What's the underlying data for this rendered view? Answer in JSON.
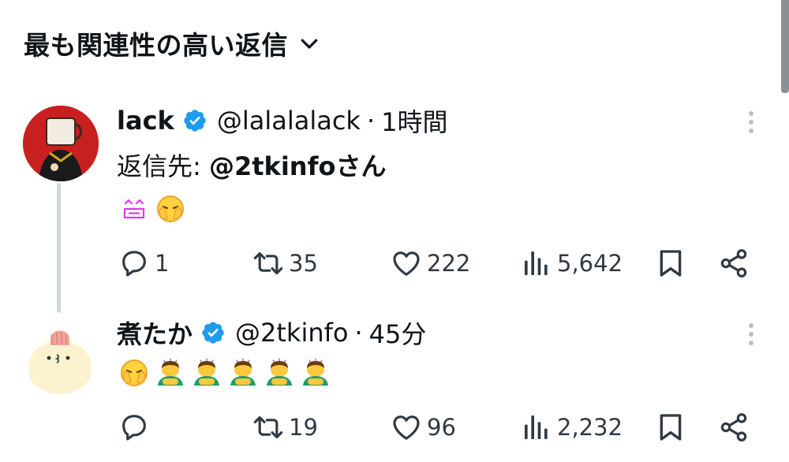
{
  "sort": {
    "label": "最も関連性の高い返信"
  },
  "tweets": [
    {
      "name": "lack",
      "handle": "@lalalalack",
      "separator": "·",
      "time": "1時間",
      "reply_to_prefix": "返信先: ",
      "reply_to_mention": "@2tkinfo",
      "reply_to_suffix": "さん",
      "emojis": [
        "pink-kaomoji-face-emoji",
        "face-in-hands-emoji"
      ],
      "stats": {
        "replies": "1",
        "retweets": "35",
        "likes": "222",
        "views": "5,642"
      }
    },
    {
      "name": "煮たか",
      "handle": "@2tkinfo",
      "separator": "·",
      "time": "45分",
      "emojis": [
        "face-in-hands-emoji",
        "person-bowing-emoji",
        "person-bowing-emoji",
        "person-bowing-emoji",
        "person-bowing-emoji",
        "person-bowing-emoji"
      ],
      "stats": {
        "replies": "",
        "retweets": "19",
        "likes": "96",
        "views": "2,232"
      }
    }
  ],
  "colors": {
    "verified": "#1d9bf0",
    "icon": "#303a44",
    "thread_line": "#cfd9de"
  }
}
